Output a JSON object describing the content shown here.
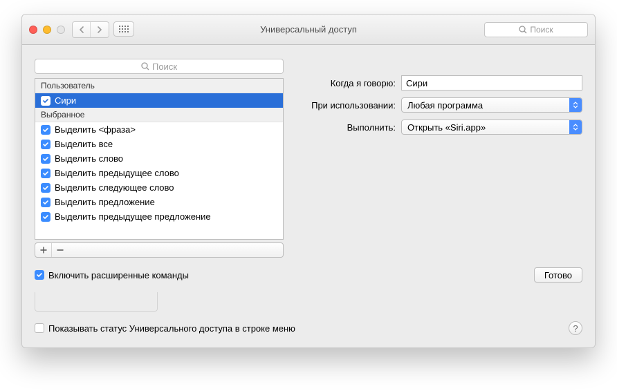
{
  "window": {
    "title": "Универсальный доступ",
    "toolbar_search_placeholder": "Поиск"
  },
  "panel_search_placeholder": "Поиск",
  "list": {
    "group1": "Пользователь",
    "group2": "Выбранное",
    "items_user": [
      "Сири"
    ],
    "items_fav": [
      "Выделить <фраза>",
      "Выделить все",
      "Выделить слово",
      "Выделить предыдущее слово",
      "Выделить следующее слово",
      "Выделить предложение",
      "Выделить предыдущее предложение"
    ]
  },
  "form": {
    "when_label": "Когда я говорю:",
    "when_value": "Сири",
    "using_label": "При использовании:",
    "using_value": "Любая программа",
    "perform_label": "Выполнить:",
    "perform_value": "Открыть «Siri.app»"
  },
  "enable_advanced": "Включить расширенные команды",
  "done": "Готово",
  "show_status": "Показывать статус Универсального доступа в строке меню"
}
